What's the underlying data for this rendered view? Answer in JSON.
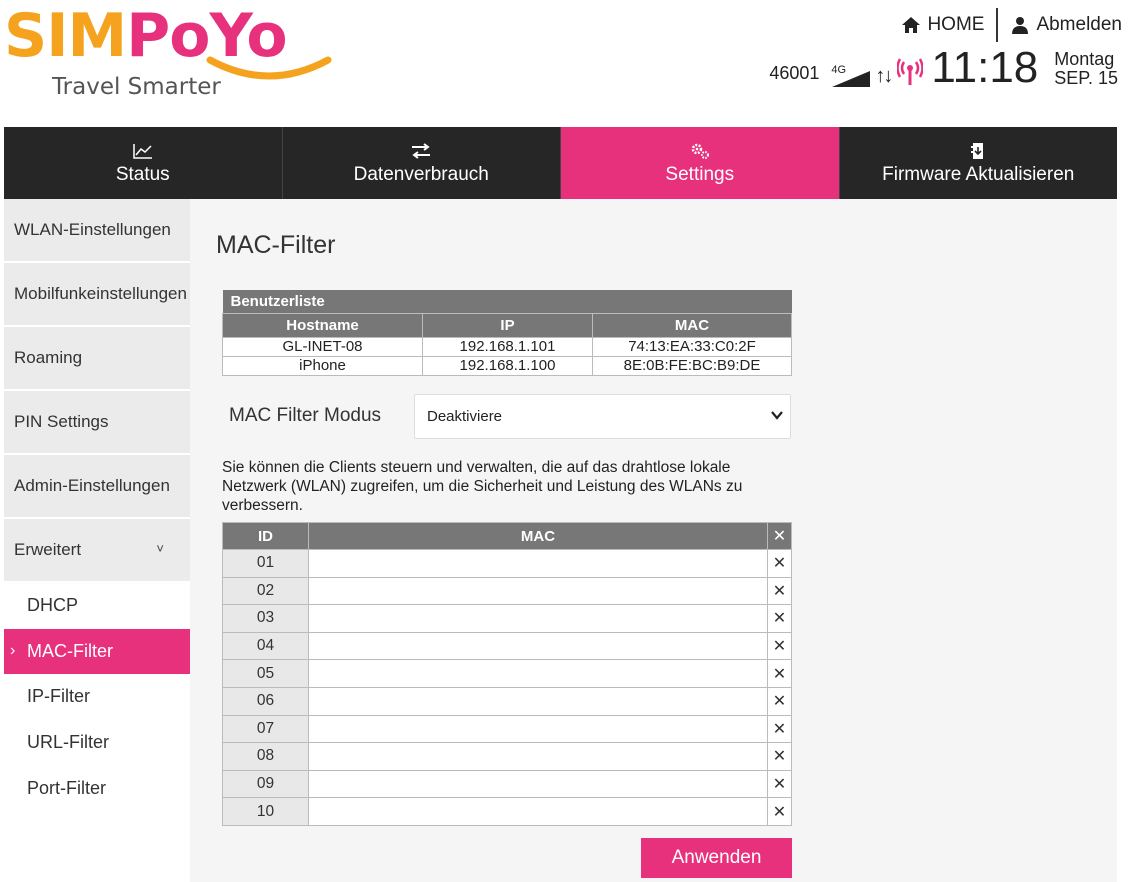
{
  "brand": {
    "logo_main": "SIMPoYo",
    "logo_part1": "SIM",
    "logo_part2": "PoYo",
    "tagline": "Travel Smarter",
    "colors": {
      "orange": "#f5a31f",
      "pink": "#e8317d"
    }
  },
  "header": {
    "home_label": "HOME",
    "logout_label": "Abmelden",
    "carrier": "46001",
    "network_type": "4G",
    "time": "11:18",
    "day": "Montag",
    "date": "SEP. 15",
    "icons": [
      "home-icon",
      "user-icon",
      "signal-icon",
      "updown-arrows-icon",
      "wifi-antenna-icon"
    ]
  },
  "nav": {
    "tabs": [
      {
        "label": "Status",
        "icon": "chart-icon",
        "active": false
      },
      {
        "label": "Datenverbrauch",
        "icon": "swap-arrows-icon",
        "active": false
      },
      {
        "label": "Settings",
        "icon": "gears-icon",
        "active": true
      },
      {
        "label": "Firmware Aktualisieren",
        "icon": "firmware-icon",
        "active": false
      }
    ]
  },
  "sidebar": {
    "items": [
      {
        "label": "WLAN-Einstellungen"
      },
      {
        "label": "Mobilfunkeinstellungen"
      },
      {
        "label": "Roaming"
      },
      {
        "label": "PIN Settings"
      },
      {
        "label": "Admin-Einstellungen"
      },
      {
        "label": "Erweitert",
        "expanded": true,
        "chevron": "˅"
      }
    ],
    "subitems": [
      {
        "label": "DHCP",
        "active": false
      },
      {
        "label": "MAC-Filter",
        "active": true,
        "marker": "›"
      },
      {
        "label": "IP-Filter",
        "active": false
      },
      {
        "label": "URL-Filter",
        "active": false
      },
      {
        "label": "Port-Filter",
        "active": false
      }
    ]
  },
  "main": {
    "title": "MAC-Filter",
    "userlist": {
      "caption": "Benutzerliste",
      "headers": [
        "Hostname",
        "IP",
        "MAC"
      ],
      "rows": [
        [
          "GL-INET-08",
          "192.168.1.101",
          "74:13:EA:33:C0:2F"
        ],
        [
          "iPhone",
          "192.168.1.100",
          "8E:0B:FE:BC:B9:DE"
        ]
      ]
    },
    "filter_mode": {
      "label": "MAC Filter Modus",
      "value": "Deaktiviere"
    },
    "description": "Sie können die Clients steuern und verwalten, die auf das drahtlose lokale Netzwerk (WLAN) zugreifen, um die Sicherheit und Leistung des WLANs zu verbessern.",
    "mac_table": {
      "headers": [
        "ID",
        "MAC",
        "✕"
      ],
      "rows": [
        {
          "id": "01",
          "mac": ""
        },
        {
          "id": "02",
          "mac": ""
        },
        {
          "id": "03",
          "mac": ""
        },
        {
          "id": "04",
          "mac": ""
        },
        {
          "id": "05",
          "mac": ""
        },
        {
          "id": "06",
          "mac": ""
        },
        {
          "id": "07",
          "mac": ""
        },
        {
          "id": "08",
          "mac": ""
        },
        {
          "id": "09",
          "mac": ""
        },
        {
          "id": "10",
          "mac": ""
        }
      ],
      "delete_glyph": "✕"
    },
    "apply_label": "Anwenden"
  }
}
